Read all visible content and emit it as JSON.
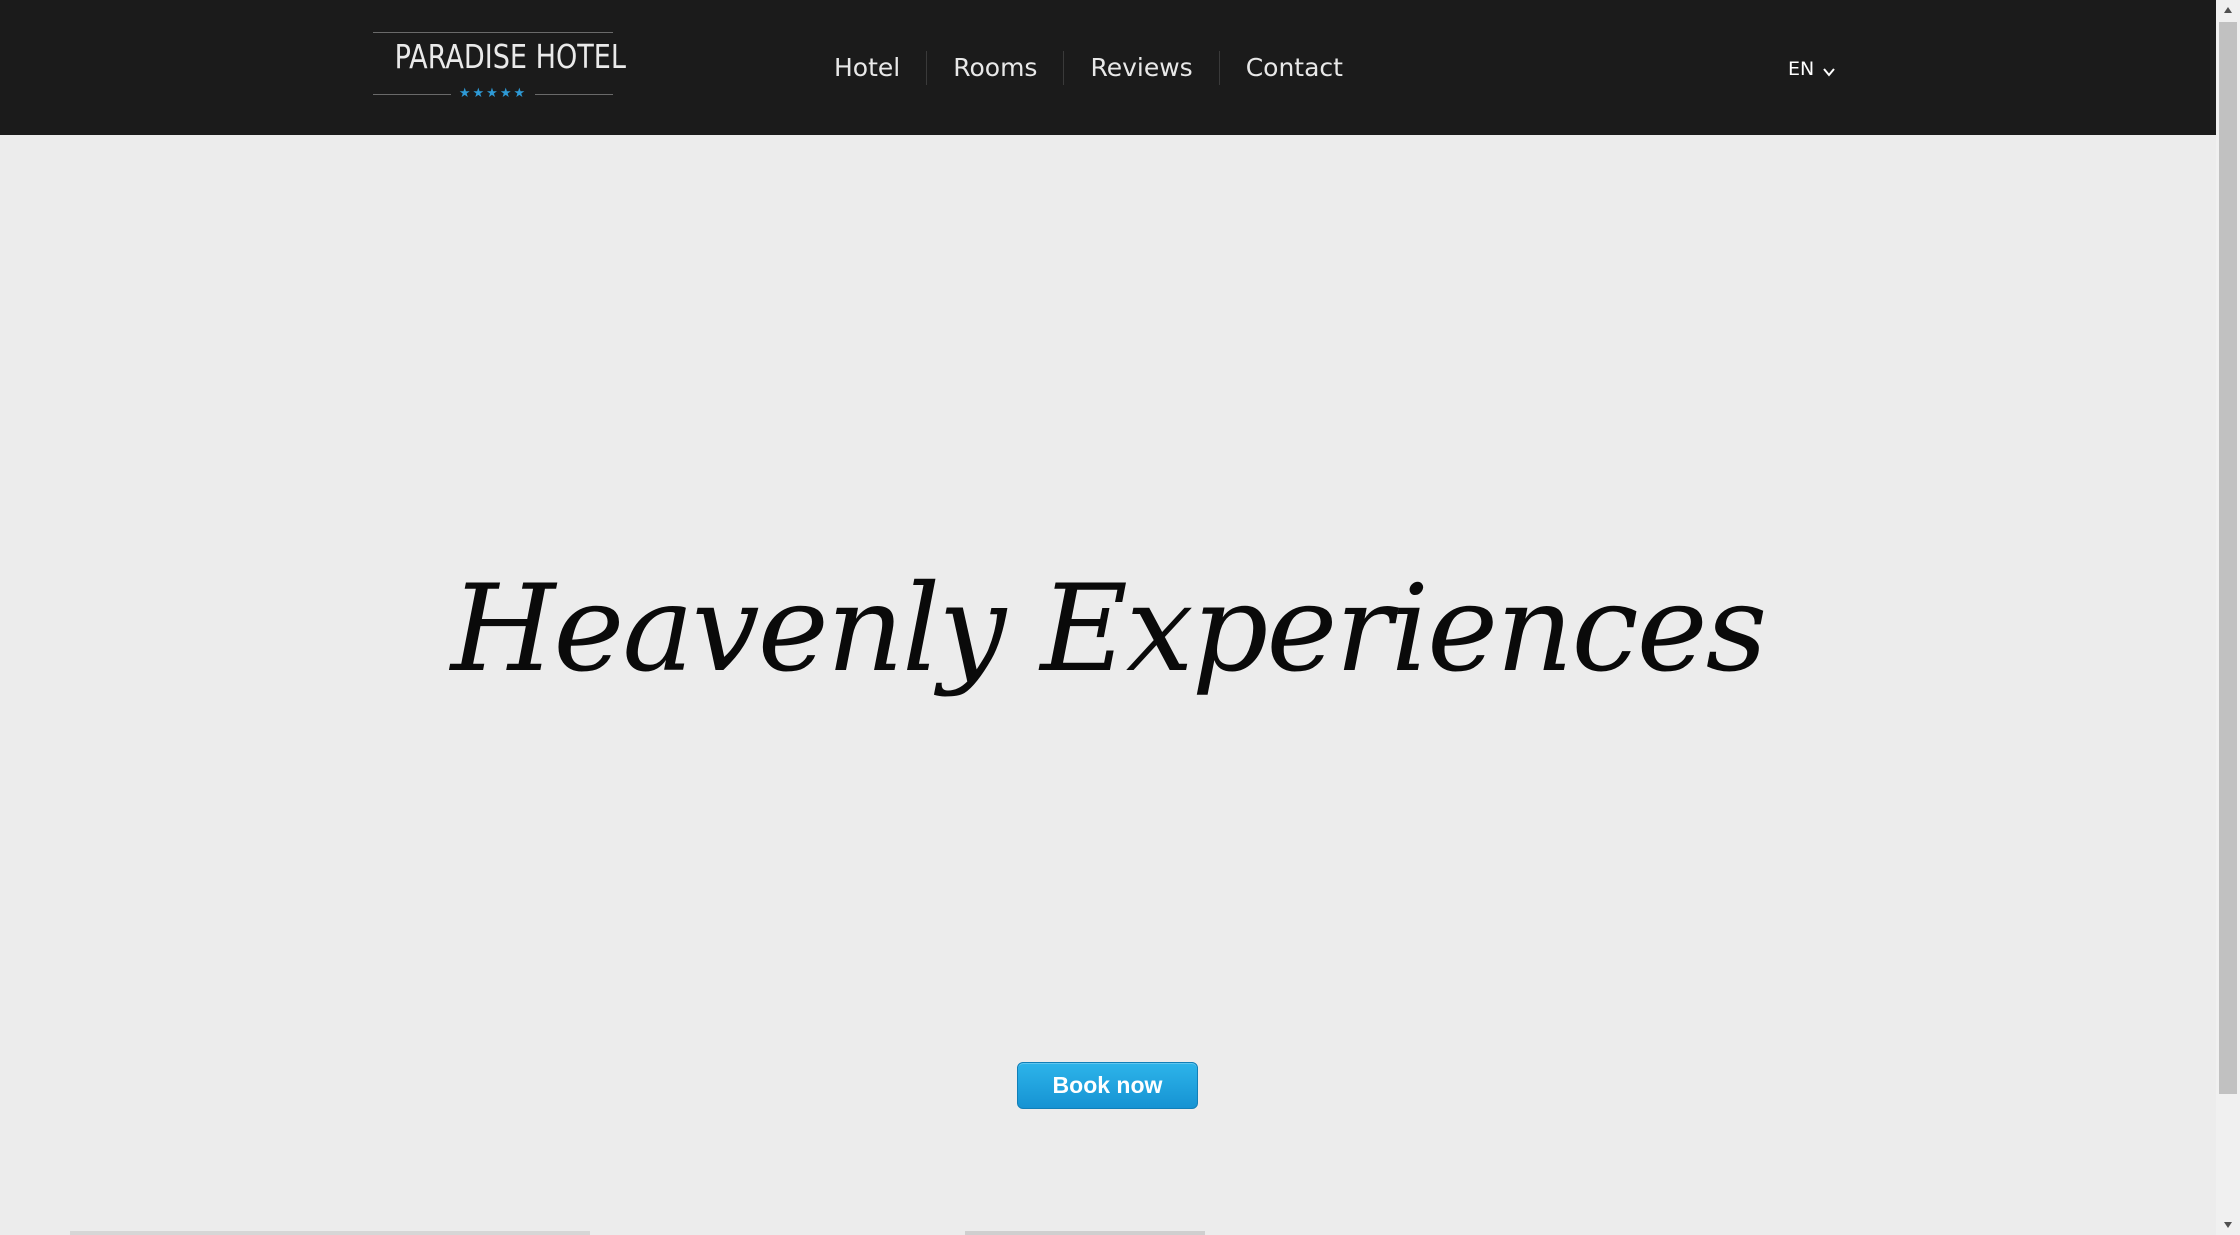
{
  "header": {
    "logo": {
      "text": "PARADISE HOTEL",
      "stars": "★★★★★",
      "star_count": 5,
      "star_color": "#2e9ad6"
    },
    "nav": [
      {
        "label": "Hotel"
      },
      {
        "label": "Rooms"
      },
      {
        "label": "Reviews"
      },
      {
        "label": "Contact"
      }
    ],
    "language": {
      "current": "EN",
      "icon": "chevron-down-icon"
    },
    "background_color": "#1b1b1b"
  },
  "hero": {
    "title": "Heavenly Experiences",
    "cta_label": "Book now",
    "cta_color": "#1fa4e0",
    "background_color": "#ececec"
  },
  "scrollbar": {
    "up_icon": "arrow-up-icon",
    "down_icon": "arrow-down-icon"
  }
}
